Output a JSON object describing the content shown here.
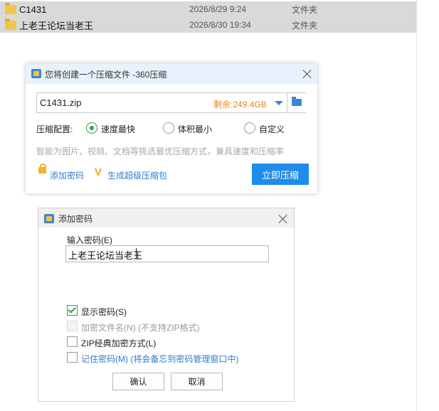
{
  "files": [
    {
      "name": "C1431",
      "date": "2026/8/29 9:24",
      "type": "文件夹"
    },
    {
      "name": "上老王论坛当老王",
      "date": "2026/8/30 19:34",
      "type": "文件夹"
    }
  ],
  "compress_dialog": {
    "title": "您将创建一个压缩文件 -360压缩",
    "path": "C1431.zip",
    "free_space": "剩余:249.4GB",
    "config_label": "压缩配置:",
    "options": [
      "速度最快",
      "体积最小",
      "自定义"
    ],
    "selected_option": "速度最快",
    "hint": "智能为图片、视频、文档等挑选最优压缩方式，兼具速度和压缩率",
    "add_password": "添加密码",
    "super_package": "生成超级压缩包",
    "compress_now": "立即压缩"
  },
  "password_dialog": {
    "title": "添加密码",
    "input_label": "输入密码(E)",
    "password_value": "上老王论坛当老王",
    "options": {
      "show_password": {
        "label": "显示密码(S)",
        "checked": true
      },
      "encrypt_filenames": {
        "label": "加密文件名(N) (不支持ZIP格式)",
        "checked": false,
        "disabled": true
      },
      "zip_classic": {
        "label": "ZIP经典加密方式(L)",
        "checked": false
      },
      "remember_password": {
        "label": "记住密码(M) (将会备忘到密码管理窗口中)",
        "checked": false
      }
    },
    "ok": "确认",
    "cancel": "取消"
  },
  "colors": {
    "accent": "#1f8ceb",
    "check_green": "#2aa147",
    "free_space_orange": "#e8861b",
    "link_blue": "#2c7cd3"
  }
}
